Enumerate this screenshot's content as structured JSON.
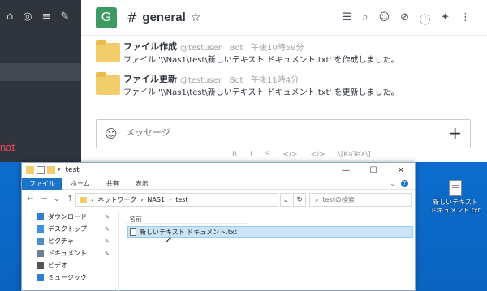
{
  "rc": {
    "sidebar_red_text": "nat",
    "channel": {
      "avatar_letter": "G",
      "hash": "#",
      "name": "general"
    },
    "messages": [
      {
        "title": "ファイル作成",
        "user": "@testuser",
        "role": "Bot",
        "time": "午後10時59分",
        "body": "ファイル '\\\\Nas1\\test\\新しいテキスト ドキュメント.txt' を作成しました。"
      },
      {
        "title": "ファイル更新",
        "user": "@testuser",
        "role": "Bot",
        "time": "午後11時4分",
        "body": "ファイル '\\\\Nas1\\test\\新しいテキスト ドキュメント.txt' を更新しました。"
      }
    ],
    "composer": {
      "placeholder": "メッセージ",
      "plus": "+"
    },
    "format": {
      "bold": "B",
      "italic": "i",
      "strike": "S",
      "code": "</>",
      "codeblock": "</>",
      "katex": "\\[KaTeX\\]"
    }
  },
  "explorer": {
    "title": "test",
    "ribbon": {
      "file": "ファイル",
      "home": "ホーム",
      "share": "共有",
      "view": "表示"
    },
    "path": [
      "ネットワーク",
      "NAS1",
      "test"
    ],
    "search_placeholder": "testの検索",
    "nav": [
      {
        "label": "ダウンロード",
        "icon": "download-icon",
        "color": "#2d7fd3"
      },
      {
        "label": "デスクトップ",
        "icon": "desktop-icon",
        "color": "#3d8fe0"
      },
      {
        "label": "ピクチャ",
        "icon": "pictures-icon",
        "color": "#4a90c8"
      },
      {
        "label": "ドキュメント",
        "icon": "documents-icon",
        "color": "#6d7f92"
      },
      {
        "label": "ビデオ",
        "icon": "videos-icon",
        "color": "#555555"
      },
      {
        "label": "ミュージック",
        "icon": "music-icon",
        "color": "#2d7fd3"
      }
    ],
    "column_name": "名前",
    "file": "新しいテキスト ドキュメント.txt"
  },
  "desktop": {
    "file_label": "新しいテキスト ドキュメント.txt"
  },
  "colors": {
    "rc_sidebar": "#2f343d",
    "accent": "#1a73c9",
    "avatar": "#3d9a62",
    "folder": "#f2cd6b",
    "selection": "#cce4f7"
  }
}
